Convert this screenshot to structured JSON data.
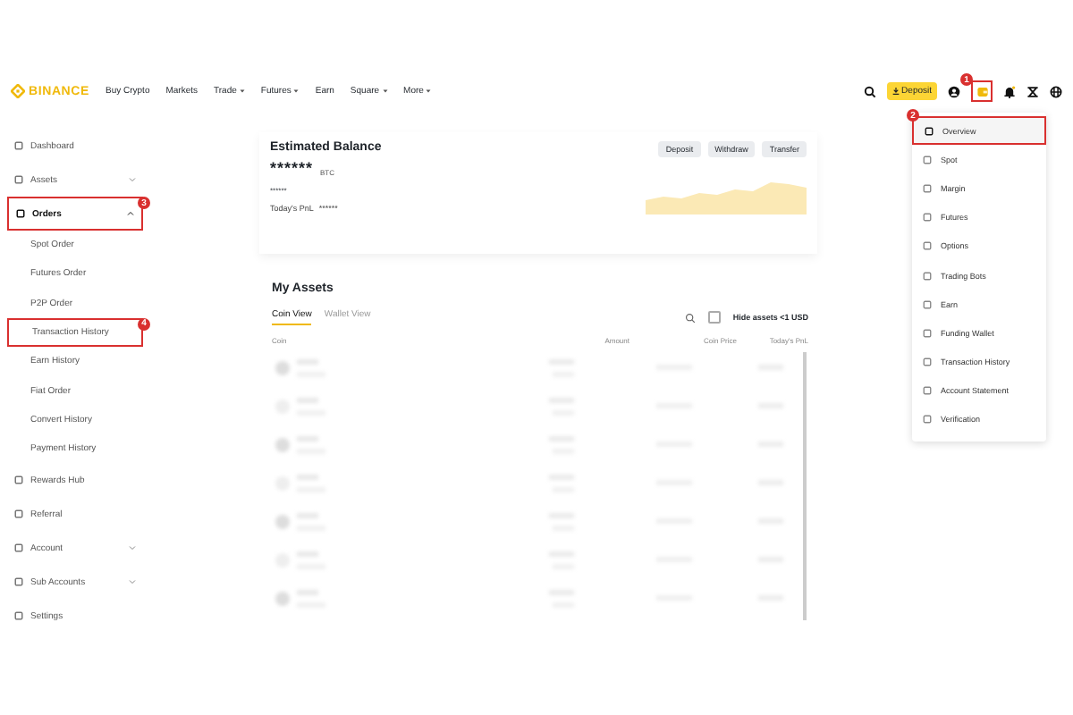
{
  "logo": {
    "text": "BINANCE"
  },
  "nav": [
    {
      "label": "Buy Crypto",
      "dropdown": false
    },
    {
      "label": "Markets",
      "dropdown": false
    },
    {
      "label": "Trade",
      "dropdown": true
    },
    {
      "label": "Futures",
      "dropdown": true
    },
    {
      "label": "Earn",
      "dropdown": false
    },
    {
      "label": "Square",
      "dropdown": true
    },
    {
      "label": "More",
      "dropdown": true
    }
  ],
  "header_actions": {
    "deposit": "Deposit",
    "wallet_marker": "1"
  },
  "sidebar": {
    "items": [
      {
        "label": "Dashboard",
        "selected": false
      },
      {
        "label": "Assets",
        "selected": false,
        "expanded": false
      },
      {
        "label": "Orders",
        "selected": true,
        "expanded": true,
        "marker": "3",
        "children": [
          {
            "label": "Spot Order"
          },
          {
            "label": "Futures Order"
          },
          {
            "label": "P2P Order"
          },
          {
            "label": "Transaction History",
            "marker": "4"
          },
          {
            "label": "Earn History"
          },
          {
            "label": "Fiat Order"
          },
          {
            "label": "Convert History"
          },
          {
            "label": "Payment History"
          }
        ]
      },
      {
        "label": "Rewards Hub",
        "selected": false
      },
      {
        "label": "Referral",
        "selected": false
      },
      {
        "label": "Account",
        "selected": false,
        "expanded": false
      },
      {
        "label": "Sub Accounts",
        "selected": false,
        "expanded": false
      },
      {
        "label": "Settings",
        "selected": false
      }
    ]
  },
  "balance": {
    "title": "Estimated Balance",
    "amount": "******",
    "unit": "BTC",
    "fiat": "******",
    "pnl_label": "Today's PnL",
    "pnl": "******",
    "buttons": [
      "Deposit",
      "Withdraw",
      "Transfer"
    ]
  },
  "assets": {
    "title": "My Assets",
    "tabs": [
      {
        "label": "Coin View",
        "selected": true
      },
      {
        "label": "Wallet View",
        "selected": false
      }
    ],
    "hide_small": {
      "label": "Hide assets <1 USD",
      "checked": false
    },
    "columns": [
      "Coin",
      "Amount",
      "Coin Price",
      "Today's PnL"
    ]
  },
  "wallet_menu": {
    "items": [
      {
        "label": "Overview",
        "selected": true,
        "marker": "2"
      },
      {
        "label": "Spot",
        "selected": false
      },
      {
        "label": "Margin",
        "selected": false
      },
      {
        "label": "Futures",
        "selected": false
      },
      {
        "label": "Options",
        "selected": false
      },
      {
        "label": "Trading Bots",
        "selected": false
      },
      {
        "label": "Earn",
        "selected": false
      },
      {
        "label": "Funding Wallet",
        "selected": false
      },
      {
        "label": "Transaction History",
        "selected": false
      },
      {
        "label": "Account Statement",
        "selected": false
      },
      {
        "label": "Verification",
        "selected": false
      }
    ]
  }
}
